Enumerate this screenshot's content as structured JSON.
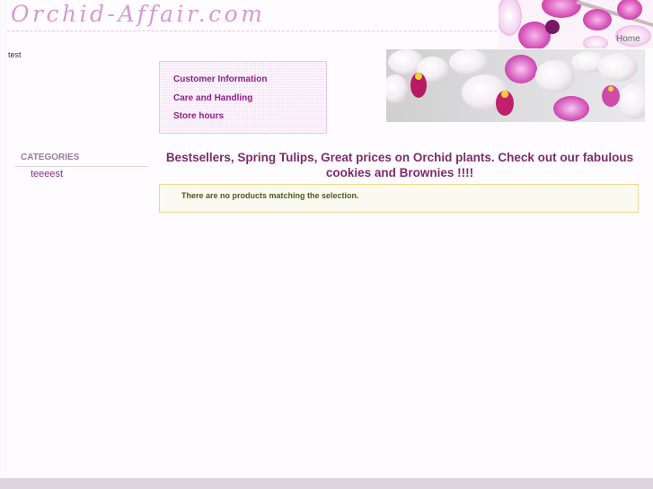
{
  "site": {
    "logo_text": "Orchid-Affair.com",
    "home_label": "Home"
  },
  "top_text": "test",
  "info_links": [
    "Customer Information",
    "Care and Handling",
    "Store hours"
  ],
  "sidebar": {
    "heading": "CATEGORIES",
    "items": [
      "teeeest"
    ]
  },
  "main": {
    "headline": "Bestsellers, Spring Tulips, Great prices on Orchid plants. Check out our fabulous cookies and Brownies !!!!",
    "notice": "There are no products matching the selection."
  },
  "colors": {
    "accent": "#8f1f8d",
    "logo": "#d49ad2",
    "headline": "#7c2c6c",
    "notice_border": "#f0d98a"
  }
}
